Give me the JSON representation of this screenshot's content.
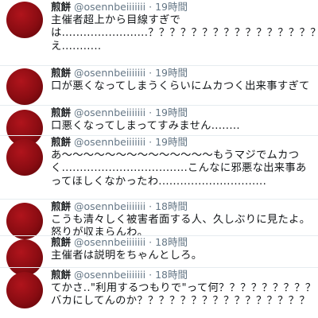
{
  "tweets": [
    {
      "name": "煎餅",
      "handle": "@osennbeiiiiiii",
      "dot": "·",
      "time": "19時間",
      "text": "主催者超上から目線すぎでは........................？？？？？？？？？？？？？？？？？？？？？？？？？？？？え..........."
    },
    {
      "name": "煎餅",
      "handle": "@osennbeiiiiiii",
      "dot": "·",
      "time": "19時間",
      "text": "口が悪くなってしまうくらいにムカつく出来事すぎて"
    },
    {
      "name": "煎餅",
      "handle": "@osennbeiiiiiii",
      "dot": "·",
      "time": "19時間",
      "text": "口悪くなってしまってすみません........"
    },
    {
      "name": "煎餅",
      "handle": "@osennbeiiiiiii",
      "dot": "·",
      "time": "19時間",
      "text": "あ～～～～～～～～～～～～～～もうマジでムカつく...................................こんなに邪悪な出来事あってほしくなかったわ.............................."
    },
    {
      "name": "煎餅",
      "handle": "@osennbeiiiiiii",
      "dot": "·",
      "time": "18時間",
      "text": "こうも清々しく被害者面する人、久しぶりに見たよ。 怒りが収まらんわ。"
    },
    {
      "name": "煎餅",
      "handle": "@osennbeiiiiiii",
      "dot": "·",
      "time": "18時間",
      "text": "主催者は説明をちゃんとしろ。"
    },
    {
      "name": "煎餅",
      "handle": "@osennbeiiiiiii",
      "dot": "·",
      "time": "18時間",
      "text": "てかさ..\"利用するつもりで\"って何？？？？？？？？？バカにしてんのか？？？？？？？？？？？？？？？？"
    }
  ],
  "colors": {
    "text": "#14171a",
    "meta": "#657786",
    "avatar": "#8a0c12",
    "divider": "#e6ecf0"
  }
}
